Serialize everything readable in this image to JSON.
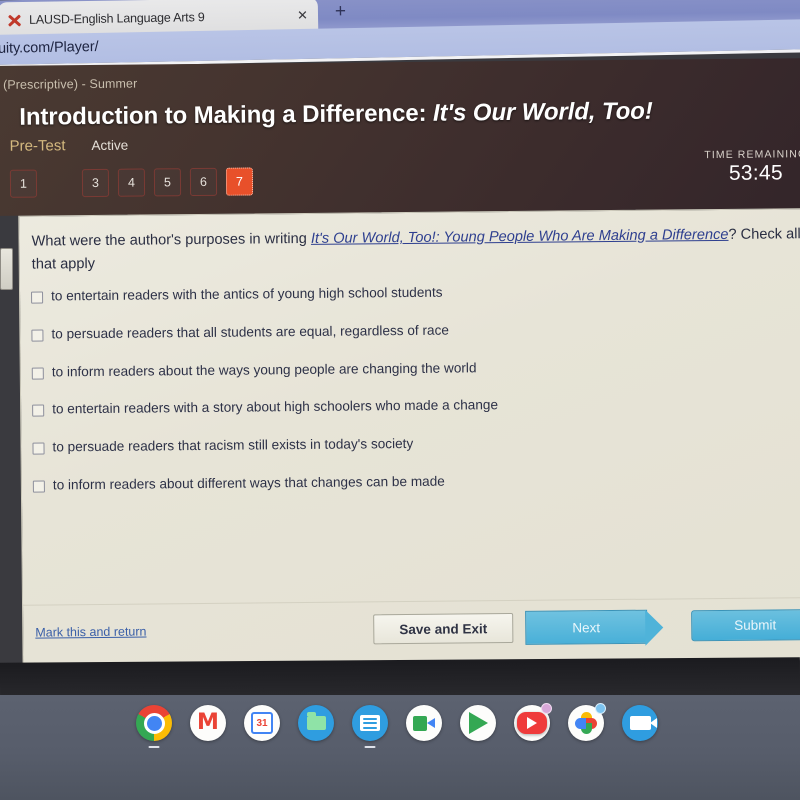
{
  "browser": {
    "tab_title": "LAUSD-English Language Arts 9",
    "tab_close_label": "✕",
    "new_tab_label": "+",
    "url": "nuity.com/Player/"
  },
  "header": {
    "course_line": "B (Prescriptive) - Summer",
    "title_main": "Introduction to Making a Difference: ",
    "title_italic": "It's Our World, Too!",
    "assessment_label": "Pre-Test",
    "status_label": "Active",
    "question_numbers": [
      "1",
      "",
      "3",
      "4",
      "5",
      "6",
      "7"
    ],
    "current_question": "7",
    "timer_label": "TIME REMAINING",
    "timer_value": "53:45",
    "accent_current": "#e8502a",
    "accent_pretest": "#d4b97f"
  },
  "question": {
    "text_before": "What were the author's purposes in writing ",
    "book_link": "It's Our World, Too!: Young People Who Are Making a Difference",
    "text_after": "? Check all that apply",
    "options": [
      "to entertain readers with the antics of young high school students",
      "to persuade readers that all students are equal, regardless of race",
      "to inform readers about the ways young people are changing the world",
      "to entertain readers with a story about high schoolers who made a change",
      "to persuade readers that racism still exists in today's society",
      "to inform readers about different ways that changes can be made"
    ]
  },
  "footer": {
    "mark_link": "Mark this and return",
    "save_label": "Save and Exit",
    "next_label": "Next",
    "submit_label": "Submit",
    "link_color": "#3a5fa8",
    "button_blue": "#49b0d8"
  },
  "shelf": {
    "icons": [
      "chrome-icon",
      "gmail-icon",
      "google-calendar-icon",
      "files-icon",
      "google-docs-icon",
      "google-meet-icon",
      "play-store-icon",
      "youtube-icon",
      "google-photos-icon",
      "camera-icon"
    ],
    "calendar_day": "31"
  }
}
